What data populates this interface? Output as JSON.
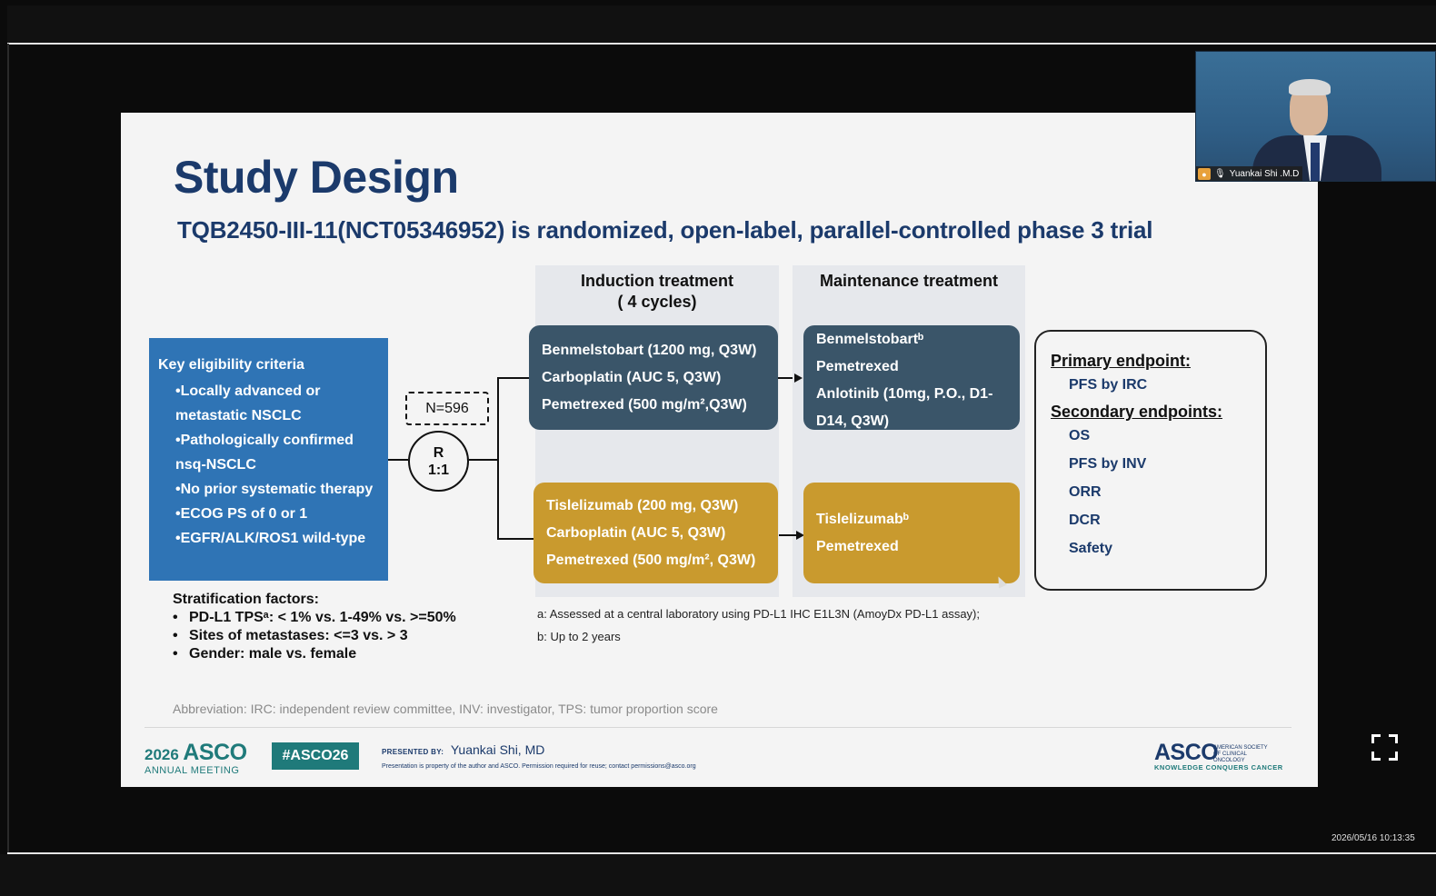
{
  "slide": {
    "title": "Study Design",
    "subtitle": "TQB2450-III-11(NCT05346952) is randomized, open-label, parallel-controlled phase 3 trial",
    "induction_header_line1": "Induction treatment",
    "induction_header_line2": "( 4 cycles)",
    "maintenance_header": "Maintenance treatment",
    "eligibility": {
      "heading": "Key eligibility criteria",
      "items": [
        "•Locally advanced or metastatic NSCLC",
        "•Pathologically confirmed nsq-NSCLC",
        "•No prior systematic therapy",
        "•ECOG PS of 0 or 1",
        "•EGFR/ALK/ROS1 wild-type"
      ]
    },
    "n_label": "N=596",
    "randomization": {
      "line1": "R",
      "line2": "1:1"
    },
    "arm_a_induction": [
      "Benmelstobart (1200 mg, Q3W)",
      "Carboplatin (AUC 5, Q3W)",
      "Pemetrexed (500 mg/m²,Q3W)"
    ],
    "arm_a_maintenance": [
      "Benmelstobartᵇ",
      "Pemetrexed",
      "Anlotinib (10mg, P.O., D1-D14, Q3W)"
    ],
    "arm_b_induction": [
      "Tislelizumab (200 mg, Q3W)",
      "Carboplatin (AUC 5, Q3W)",
      "Pemetrexed (500 mg/m², Q3W)"
    ],
    "arm_b_maintenance": [
      "Tislelizumabᵇ",
      "Pemetrexed"
    ],
    "primary_endpoint_label": "Primary endpoint:",
    "primary_endpoints": [
      "PFS  by IRC"
    ],
    "secondary_endpoint_label": "Secondary endpoints:",
    "secondary_endpoints": [
      "OS",
      "PFS  by INV",
      "ORR",
      "DCR",
      "Safety"
    ],
    "stratification_heading": "Stratification factors:",
    "stratification_items": [
      "PD-L1 TPSᵃ:  < 1% vs. 1-49% vs. >=50%",
      "Sites of metastases: <=3 vs.  > 3",
      "Gender: male vs. female"
    ],
    "footnote_a": "a: Assessed at a central laboratory using PD-L1 IHC E1L3N  (AmoyDx PD-L1 assay);",
    "footnote_b": "b: Up to 2 years",
    "abbreviation": "Abbreviation: IRC: independent review committee, INV: investigator, TPS: tumor proportion score",
    "footer": {
      "meeting_year": "2026",
      "meeting_word": "ASCO",
      "meeting_sub": "ANNUAL MEETING",
      "hashtag": "#ASCO26",
      "presented_by_label": "PRESENTED BY:",
      "presenter": "Yuankai Shi, MD",
      "property_notice": "Presentation is property of the author and ASCO. Permission required for reuse; contact permissions@asco.org",
      "asco_logo_word": "ASCO",
      "asco_logo_side": "AMERICAN SOCIETY OF CLINICAL ONCOLOGY",
      "asco_tagline": "KNOWLEDGE CONQUERS CANCER"
    }
  },
  "video": {
    "participant_name": "Yuankai Shi .M.D",
    "timestamp": "2026/05/16 10:13:35"
  },
  "colors": {
    "title_navy": "#1b3a6b",
    "eligibility_blue": "#2f74b5",
    "arm_navy": "#3a5569",
    "arm_gold": "#c99a2e",
    "asco_teal": "#1f7a7a"
  },
  "icons": {
    "user_icon": "person-badge",
    "mic_icon": "microphone",
    "fullscreen_icon": "expand-corners"
  }
}
